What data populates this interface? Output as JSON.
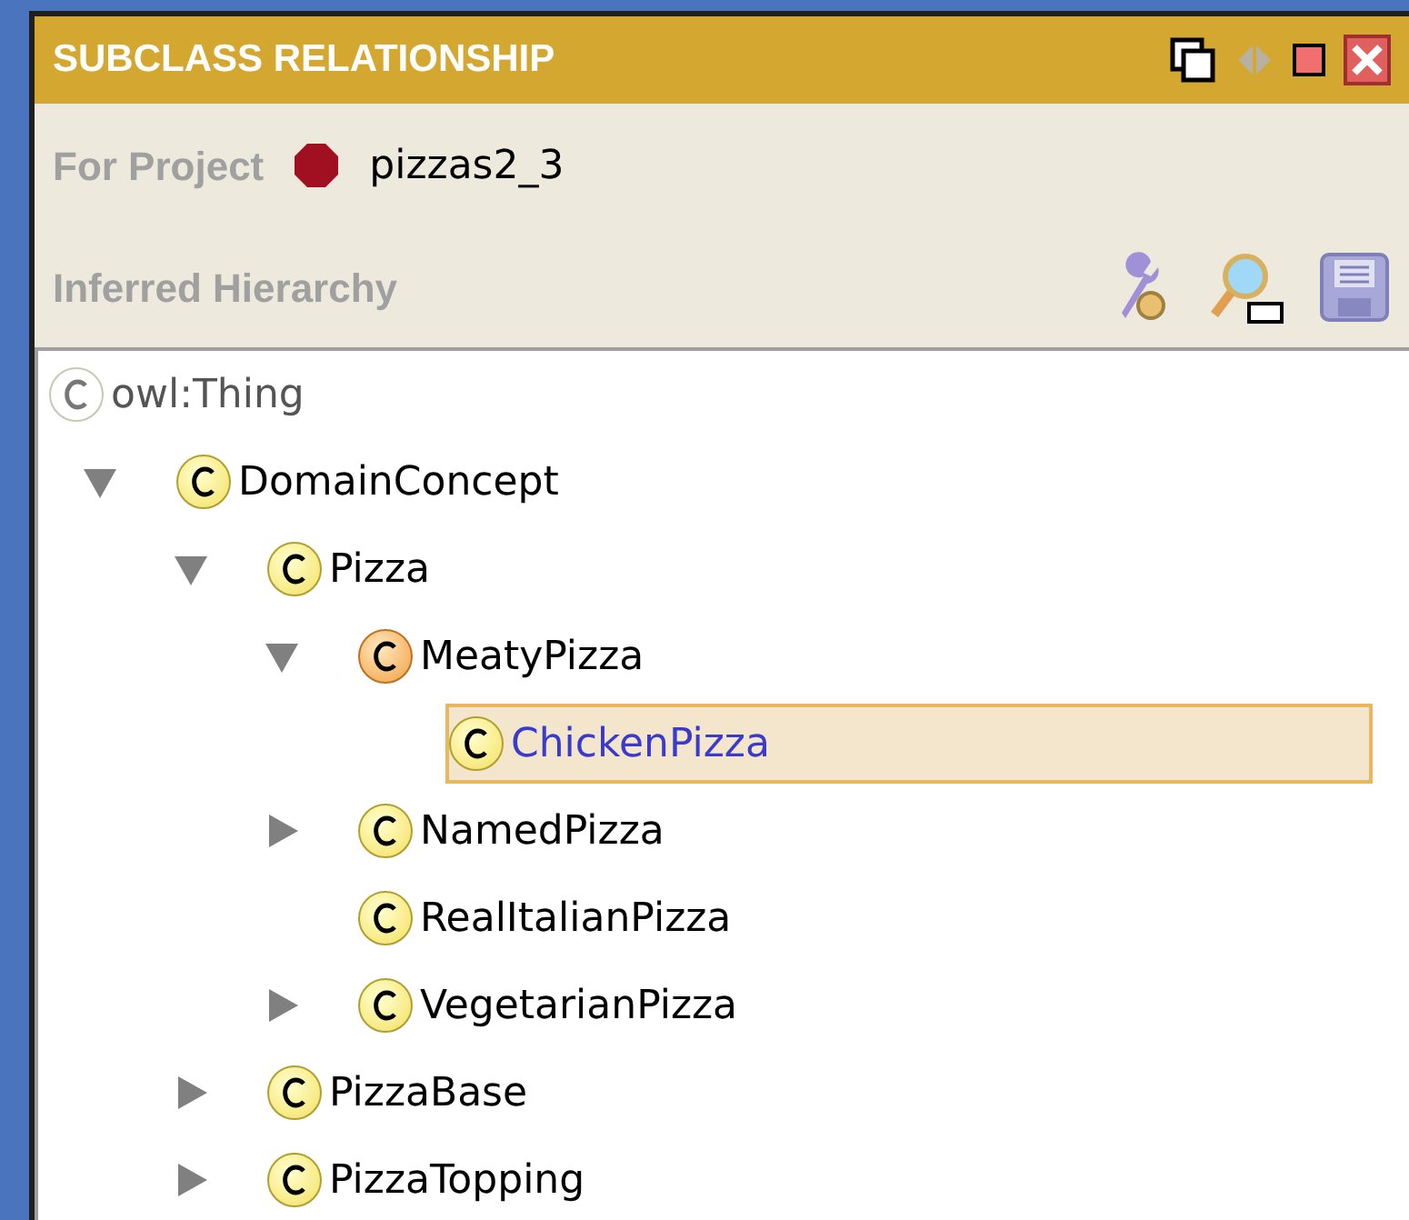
{
  "panel": {
    "title": "SUBCLASS RELATIONSHIP"
  },
  "project": {
    "label": "For Project",
    "name": "pizzas2_3"
  },
  "hierarchy": {
    "title": "Inferred Hierarchy"
  },
  "tree": [
    {
      "label": "owl:Thing",
      "kind": "root",
      "selected": false,
      "children": [
        {
          "label": "DomainConcept",
          "kind": "primitive",
          "selected": false,
          "expanded": true,
          "children": [
            {
              "label": "Pizza",
              "kind": "primitive",
              "selected": false,
              "expanded": true,
              "children": [
                {
                  "label": "MeatyPizza",
                  "kind": "defined",
                  "selected": false,
                  "expanded": true,
                  "children": [
                    {
                      "label": "ChickenPizza",
                      "kind": "primitive",
                      "selected": true
                    }
                  ]
                },
                {
                  "label": "NamedPizza",
                  "kind": "primitive",
                  "selected": false,
                  "expanded": false
                },
                {
                  "label": "RealItalianPizza",
                  "kind": "primitive",
                  "selected": false
                },
                {
                  "label": "VegetarianPizza",
                  "kind": "primitive",
                  "selected": false,
                  "expanded": false
                }
              ]
            },
            {
              "label": "PizzaBase",
              "kind": "primitive",
              "selected": false,
              "expanded": false
            },
            {
              "label": "PizzaTopping",
              "kind": "primitive",
              "selected": false,
              "expanded": false
            }
          ]
        }
      ]
    }
  ]
}
